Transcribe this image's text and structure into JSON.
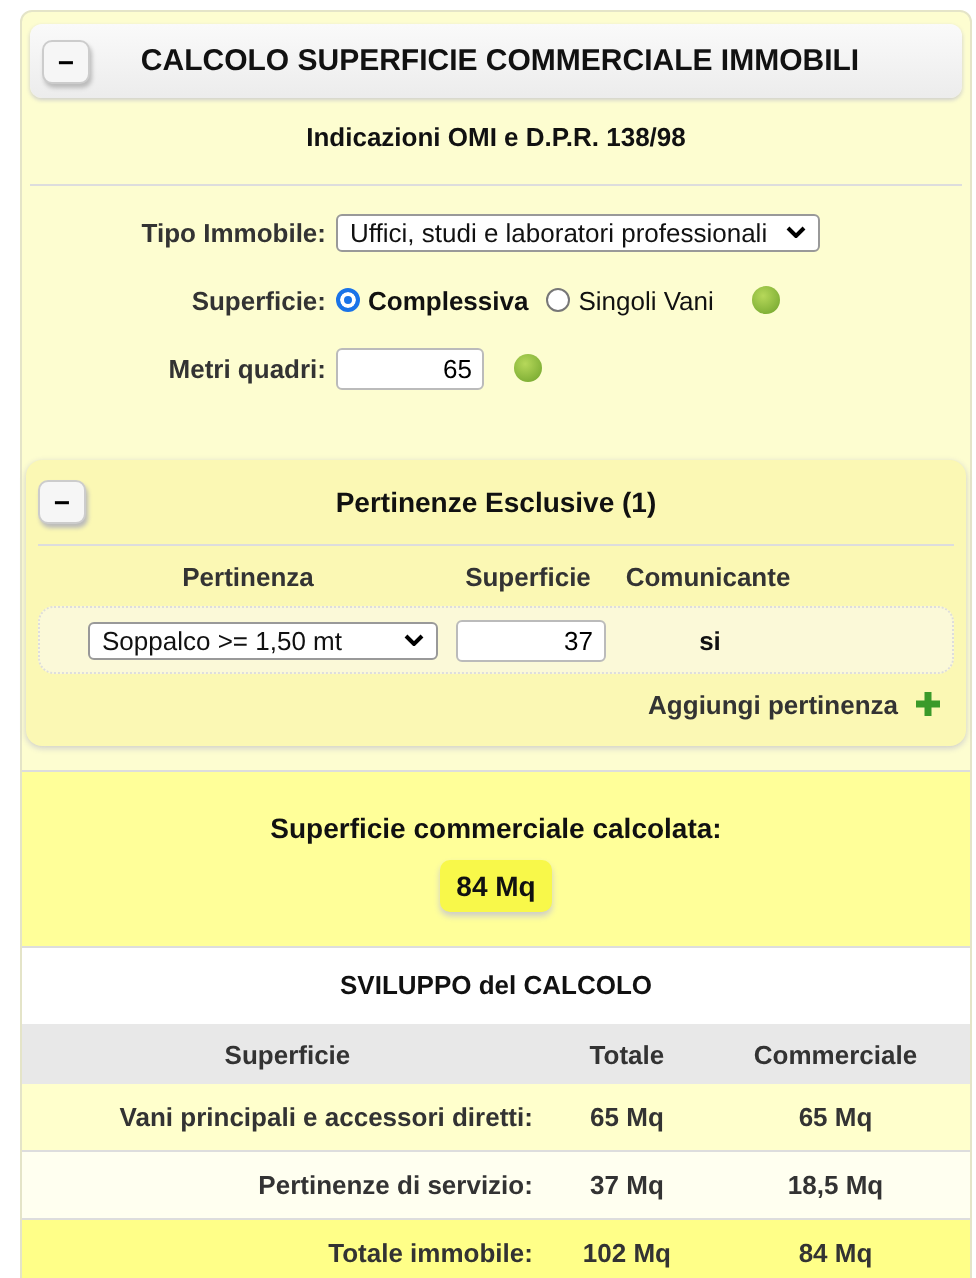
{
  "header": {
    "title": "CALCOLO SUPERFICIE COMMERCIALE IMMOBILI",
    "toggle": "−",
    "subtitle": "Indicazioni OMI e D.P.R. 138/98"
  },
  "form": {
    "tipo_label": "Tipo Immobile:",
    "tipo_value": "Uffici, studi e laboratori professionali",
    "superficie_label": "Superficie:",
    "superficie_options": [
      {
        "label": "Complessiva",
        "selected": true
      },
      {
        "label": "Singoli Vani",
        "selected": false
      }
    ],
    "metri_label": "Metri quadri:",
    "metri_value": "65"
  },
  "pertinenze": {
    "title": "Pertinenze Esclusive (1)",
    "toggle": "−",
    "columns": [
      "Pertinenza",
      "Superficie",
      "Comunicante"
    ],
    "rows": [
      {
        "pertinenza": "Soppalco >= 1,50 mt",
        "superficie": "37",
        "comunicante": "si"
      }
    ],
    "add_label": "Aggiungi pertinenza"
  },
  "result": {
    "label": "Superficie commerciale calcolata:",
    "value": "84 Mq"
  },
  "sviluppo": {
    "title": "SVILUPPO del CALCOLO",
    "columns": [
      "Superficie",
      "Totale",
      "Commerciale"
    ],
    "rows": [
      {
        "kind": "item",
        "label": "Vani principali e accessori diretti:",
        "totale": "65 Mq",
        "commerciale": "65 Mq"
      },
      {
        "kind": "item",
        "label": "Pertinenze di servizio:",
        "totale": "37 Mq",
        "commerciale": "18,5 Mq"
      },
      {
        "kind": "total",
        "label": "Totale immobile:",
        "totale": "102 Mq",
        "commerciale": "84 Mq"
      }
    ]
  }
}
